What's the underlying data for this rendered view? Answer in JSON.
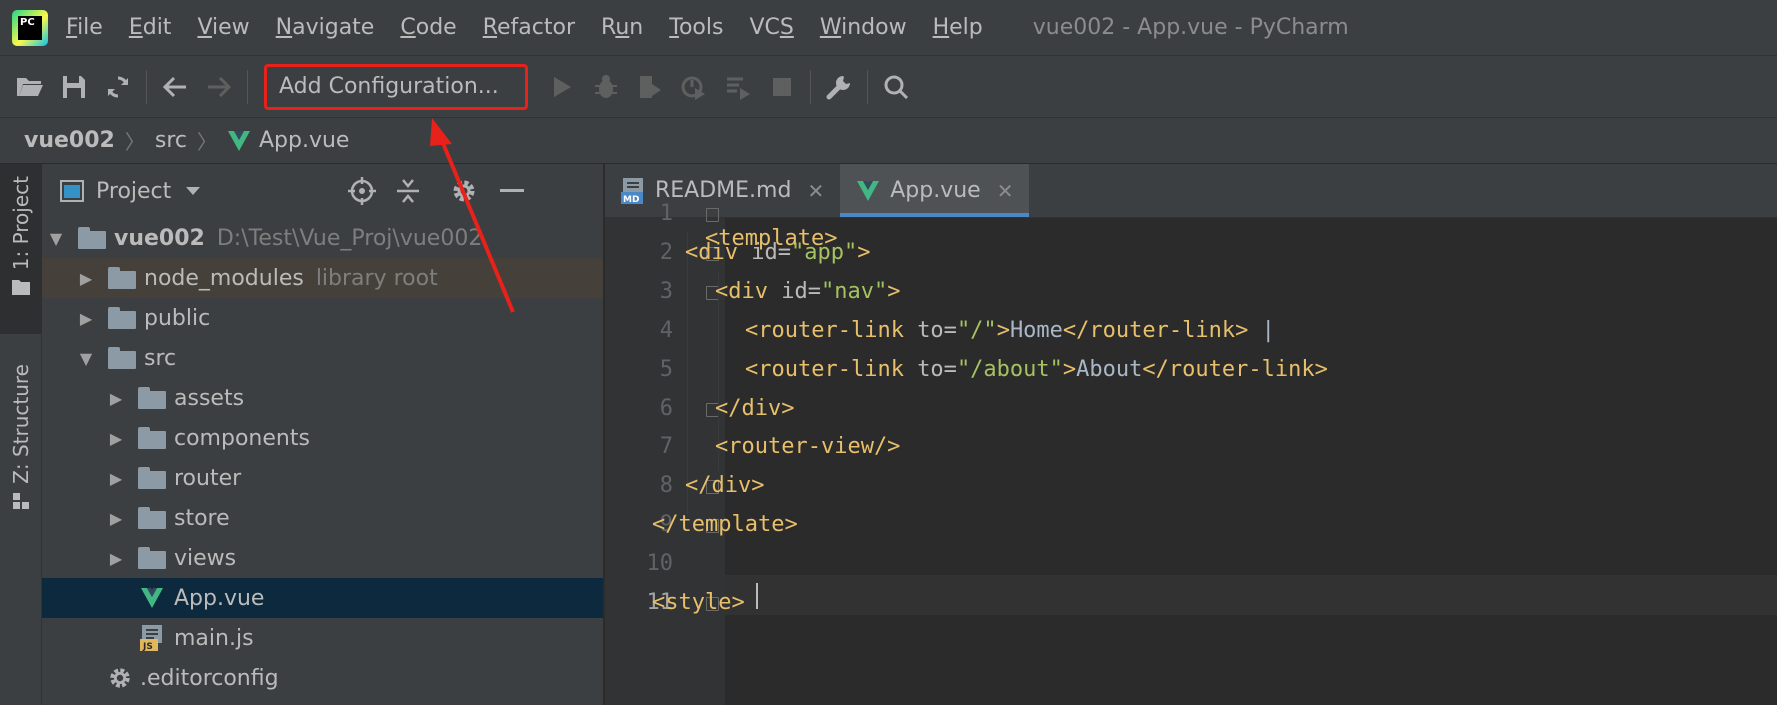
{
  "menubar": {
    "app_logo_text": "PC",
    "items": [
      {
        "pre": "",
        "ul": "F",
        "post": "ile"
      },
      {
        "pre": "",
        "ul": "E",
        "post": "dit"
      },
      {
        "pre": "",
        "ul": "V",
        "post": "iew"
      },
      {
        "pre": "",
        "ul": "N",
        "post": "avigate"
      },
      {
        "pre": "",
        "ul": "C",
        "post": "ode"
      },
      {
        "pre": "",
        "ul": "R",
        "post": "efactor"
      },
      {
        "pre": "R",
        "ul": "u",
        "post": "n"
      },
      {
        "pre": "",
        "ul": "T",
        "post": "ools"
      },
      {
        "pre": "VC",
        "ul": "S",
        "post": ""
      },
      {
        "pre": "",
        "ul": "W",
        "post": "indow"
      },
      {
        "pre": "",
        "ul": "H",
        "post": "elp"
      }
    ],
    "window_title": "vue002 - App.vue - PyCharm"
  },
  "toolbar": {
    "add_configuration_label": "Add Configuration...",
    "highlight_color": "#e8211a"
  },
  "breadcrumb": {
    "project": "vue002",
    "folder": "src",
    "file": "App.vue"
  },
  "tool_strip": {
    "project_tab": "1: Project",
    "structure_tab": "Z: Structure"
  },
  "project_panel": {
    "title": "Project",
    "root": {
      "name": "vue002",
      "path": "D:\\Test\\Vue_Proj\\vue002"
    },
    "tree": [
      {
        "label": "node_modules",
        "hint": "library root"
      },
      {
        "label": "public"
      },
      {
        "label": "src"
      },
      {
        "label": "assets"
      },
      {
        "label": "components"
      },
      {
        "label": "router"
      },
      {
        "label": "store"
      },
      {
        "label": "views"
      },
      {
        "label": "App.vue"
      },
      {
        "label": "main.js"
      },
      {
        "label": ".editorconfig"
      }
    ]
  },
  "editor": {
    "tabs": [
      {
        "label": "README.md",
        "icon_text": "MD"
      },
      {
        "label": "App.vue"
      }
    ],
    "line_numbers": [
      "1",
      "2",
      "3",
      "4",
      "5",
      "6",
      "7",
      "8",
      "9",
      "10",
      "11"
    ],
    "code": {
      "l1": {
        "tag": "<template>"
      },
      "l2": {
        "open": "<div ",
        "attr": "id=",
        "val": "\"app\"",
        "close": ">"
      },
      "l3": {
        "open": "<div ",
        "attr": "id=",
        "val": "\"nav\"",
        "close": ">"
      },
      "l4": {
        "open": "<router-link ",
        "attr": "to=",
        "val": "\"/\"",
        "close": ">",
        "text": "Home",
        "end": "</router-link>",
        "sep": " |"
      },
      "l5": {
        "open": "<router-link ",
        "attr": "to=",
        "val": "\"/about\"",
        "close": ">",
        "text": "About",
        "end": "</router-link>"
      },
      "l6": {
        "tag": "</div>"
      },
      "l7": {
        "tag": "<router-view/>"
      },
      "l8": {
        "tag": "</div>"
      },
      "l9": {
        "tag": "</template>"
      },
      "l11": {
        "tag": "<style>"
      }
    }
  },
  "colors": {
    "vue_green": "#41b883",
    "vue_dark": "#35495e",
    "tag": "#e8bf6a",
    "string": "#a5c261"
  }
}
